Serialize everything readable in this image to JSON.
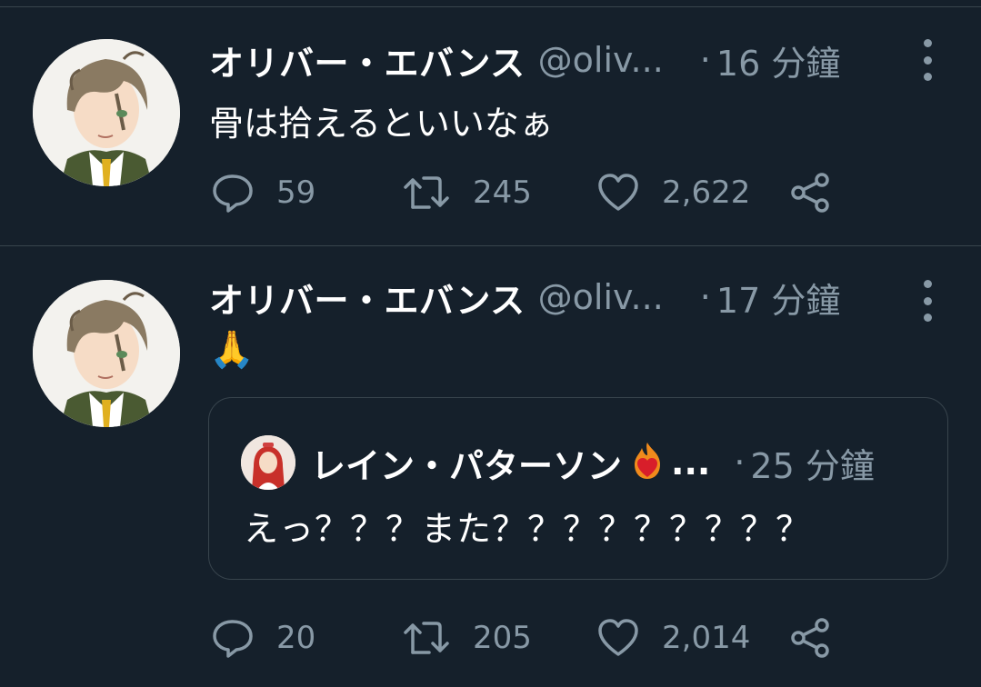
{
  "tweets": [
    {
      "author_name": "オリバー・エバンス",
      "author_handle": "@oliv...",
      "dot": "·",
      "time": "16 分鐘",
      "text": "骨は拾えるといいなぁ",
      "replies": "59",
      "retweets": "245",
      "likes": "2,622"
    },
    {
      "author_name": "オリバー・エバンス",
      "author_handle": "@oliv...",
      "dot": "·",
      "time": "17 分鐘",
      "text": "🙏",
      "replies": "20",
      "retweets": "205",
      "likes": "2,014",
      "quoted": {
        "author_name": "レイン・パターソン",
        "ellipsis": "...",
        "dot": "·",
        "time": "25 分鐘",
        "text": "えっ？？？また？？？？？？？？？"
      }
    }
  ],
  "colors": {
    "background": "#15202b",
    "text_primary": "#ffffff",
    "text_secondary": "#8899a6",
    "border": "#38444d"
  },
  "icons": [
    "reply-icon",
    "retweet-icon",
    "like-icon",
    "share-icon",
    "more-icon",
    "fire-heart-emoji",
    "folded-hands-emoji"
  ]
}
